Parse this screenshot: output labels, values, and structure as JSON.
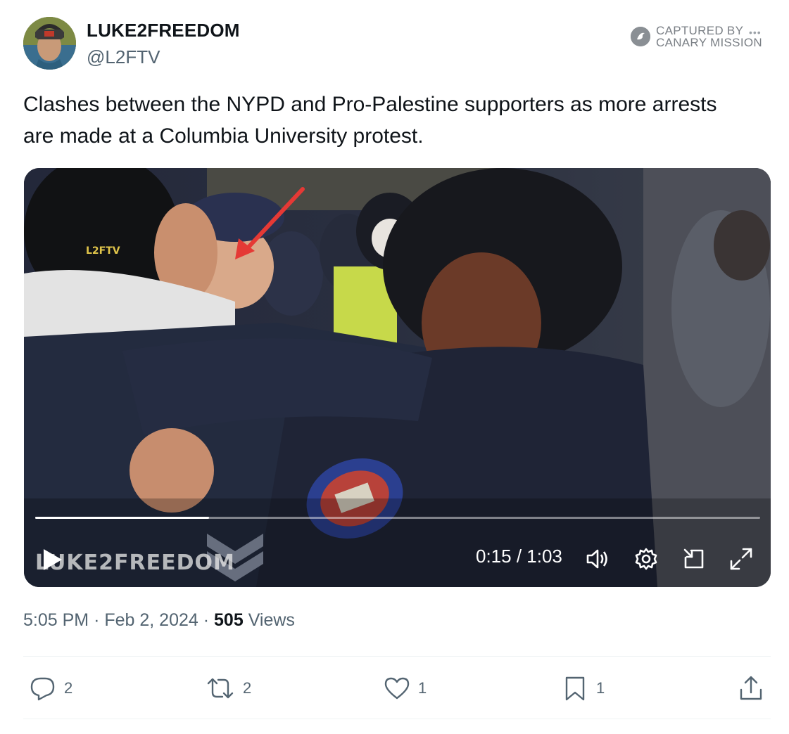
{
  "user": {
    "display_name": "LUKE2FREEDOM",
    "handle": "@L2FTV",
    "avatar_icon": "avatar"
  },
  "captured_badge": {
    "line1": "CAPTURED BY",
    "line2": "CANARY MISSION",
    "dots": "•••"
  },
  "tweet": {
    "text": "Clashes between the NYPD and Pro-Palestine supporters as more arrests are made at a Columbia University protest."
  },
  "video": {
    "watermark": "LUKE2FREEDOM",
    "overlay_text": "L2FTV",
    "current_time": "0:15",
    "duration": "1:03",
    "time_display": "0:15 / 1:03",
    "progress_fraction": 0.24
  },
  "meta": {
    "time": "5:05 PM",
    "date": "Feb 2, 2024",
    "separator": "·",
    "views_count": "505",
    "views_label": "Views"
  },
  "actions": {
    "replies": "2",
    "retweets": "2",
    "likes": "1",
    "bookmarks": "1"
  },
  "colors": {
    "text_primary": "#0f1419",
    "text_secondary": "#536471",
    "divider": "#eff3f4",
    "arrow": "#e53935"
  }
}
